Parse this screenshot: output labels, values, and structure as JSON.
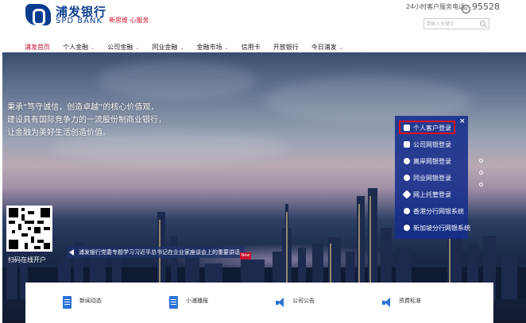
{
  "brand": {
    "name_cn": "浦发银行",
    "name_en": "SPD BANK",
    "slogan": "新思维 心服务"
  },
  "topbar": {
    "hotline_label": "24小时客户服务电话",
    "phone": "95528",
    "search_placeholder": "请输入关键字"
  },
  "nav": {
    "items": [
      {
        "label": "浦发首页",
        "active": true,
        "has_menu": false
      },
      {
        "label": "个人金融",
        "has_menu": true
      },
      {
        "label": "公司金融",
        "has_menu": true
      },
      {
        "label": "同业金融",
        "has_menu": true
      },
      {
        "label": "金融市场",
        "has_menu": true
      },
      {
        "label": "信用卡",
        "has_menu": false
      },
      {
        "label": "开放银行",
        "has_menu": false
      },
      {
        "label": "今日浦发",
        "has_menu": true
      }
    ],
    "chevron": "⌄"
  },
  "banner": {
    "lines": [
      "秉承“笃守诚信，创造卓越”的核心价值观，",
      "建设具有国际竞争力的一流股份制商业银行，",
      "让金融为美好生活创造价值。"
    ],
    "qr_label": "扫码在线开户",
    "news_text": "浦发银行党委专题学习习近平总书记在企业家座谈会上的重要讲话",
    "news_tag": "New"
  },
  "login_panel": {
    "close": "×",
    "items": [
      {
        "label": "个人客户登录",
        "icon": "person-icon"
      },
      {
        "label": "公司网银登录",
        "icon": "building-icon"
      },
      {
        "label": "离岸网银登录",
        "icon": "globe-icon"
      },
      {
        "label": "同业网银登录",
        "icon": "gear-icon"
      },
      {
        "label": "网上托管登录",
        "icon": "diamond-icon"
      },
      {
        "label": "香港分行网银系统",
        "icon": "hk-icon"
      },
      {
        "label": "新加坡分行网银系统",
        "icon": "sg-icon"
      }
    ]
  },
  "bottom": {
    "items": [
      {
        "label": "新闻动态",
        "icon": "document-icon"
      },
      {
        "label": "小浦播报",
        "icon": "document-icon"
      },
      {
        "label": "公司公告",
        "icon": "speaker-icon"
      },
      {
        "label": "资费标准",
        "icon": "speaker-icon"
      }
    ]
  },
  "colors": {
    "brand_blue": "#0a3d8f",
    "brand_red": "#c8102e",
    "panel_blue": "#142d8c"
  }
}
